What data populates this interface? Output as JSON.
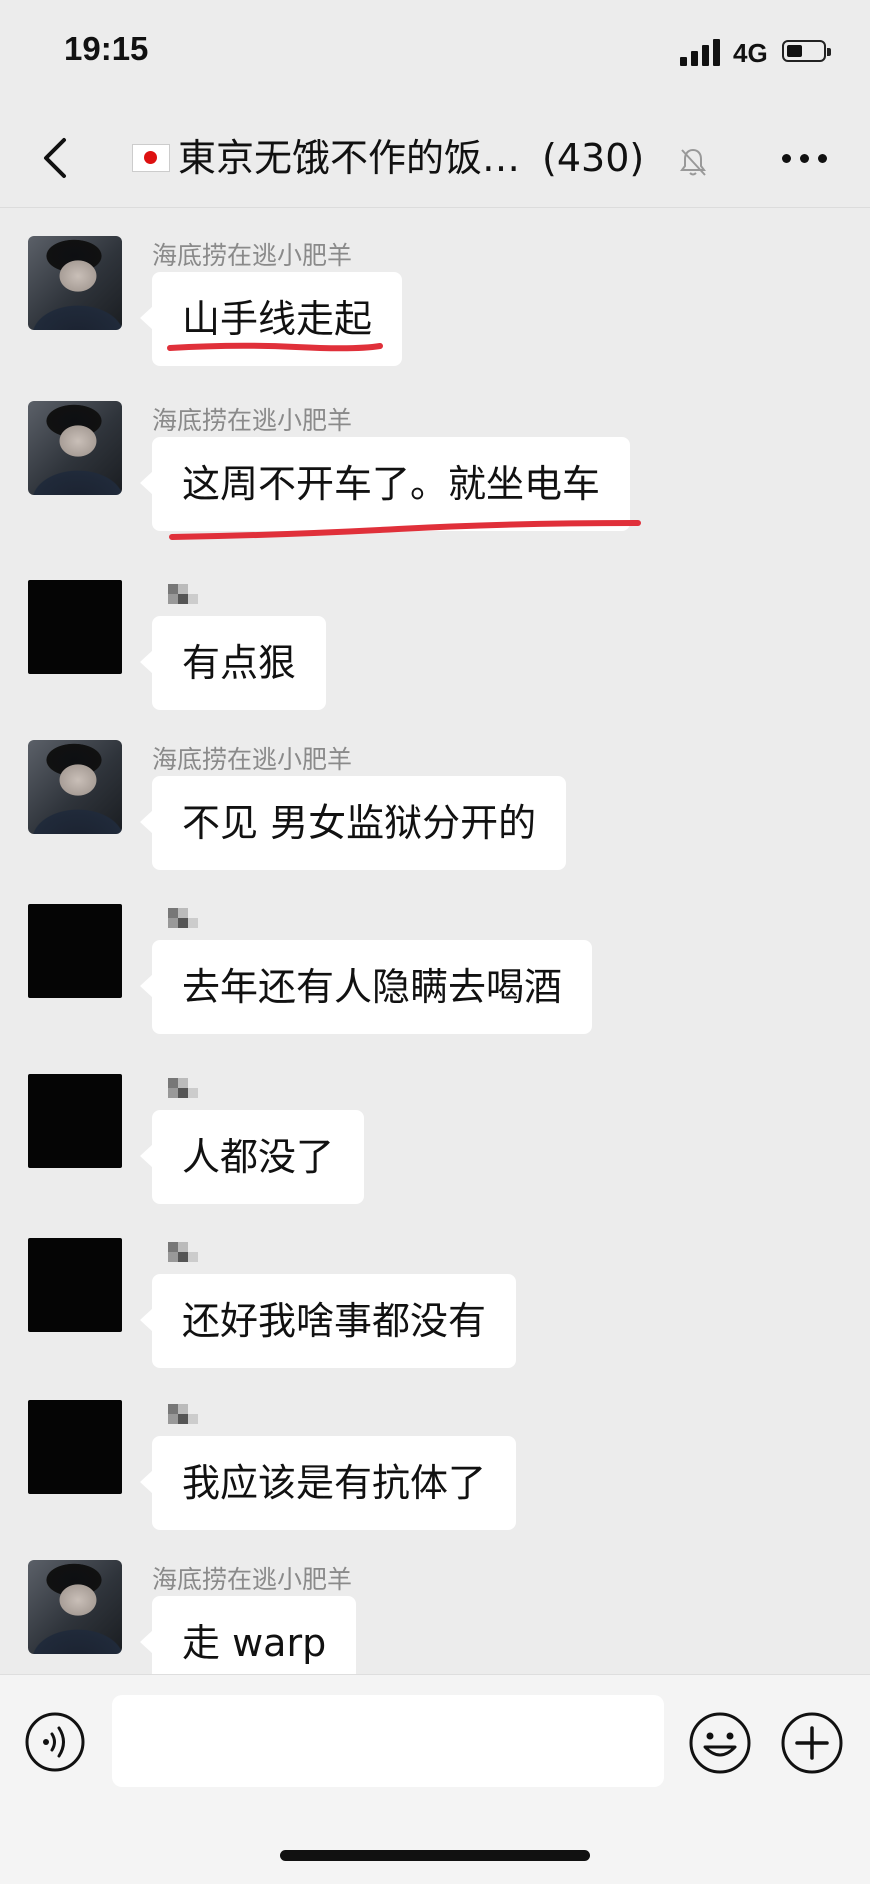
{
  "status_bar": {
    "time": "19:15",
    "network": "4G",
    "battery_level": 0.45
  },
  "header": {
    "title": "東京无饿不作的饭…",
    "member_count": "(430)",
    "flag_icon": "japan-flag-icon",
    "mute_icon": "muted-bell-icon",
    "back_icon": "chevron-left-icon",
    "more_icon": "ellipsis-icon"
  },
  "messages": [
    {
      "sender": "海底捞在逃小肥羊",
      "text": "山手线走起",
      "underlined": true,
      "avatar": "person"
    },
    {
      "sender": "海底捞在逃小肥羊",
      "text": "这周不开车了。就坐电车",
      "underlined": true,
      "avatar": "person"
    },
    {
      "sender": "",
      "text": "有点狠",
      "underlined": false,
      "avatar": "blacked"
    },
    {
      "sender": "海底捞在逃小肥羊",
      "text": "不见 男女监狱分开的",
      "underlined": false,
      "avatar": "person"
    },
    {
      "sender": "",
      "text": "去年还有人隐瞒去喝酒",
      "underlined": false,
      "avatar": "blacked"
    },
    {
      "sender": "",
      "text": "人都没了",
      "underlined": false,
      "avatar": "blacked"
    },
    {
      "sender": "",
      "text": "还好我啥事都没有",
      "underlined": false,
      "avatar": "blacked"
    },
    {
      "sender": "",
      "text": "我应该是有抗体了",
      "underlined": false,
      "avatar": "blacked"
    },
    {
      "sender": "海底捞在逃小肥羊",
      "text": "走 warp",
      "underlined": false,
      "avatar": "person"
    }
  ],
  "annotation_color": "#e0303a",
  "input_bar": {
    "input_value": "",
    "voice_icon": "voice-icon",
    "emoji_icon": "emoji-smile-icon",
    "plus_icon": "plus-circle-icon"
  }
}
